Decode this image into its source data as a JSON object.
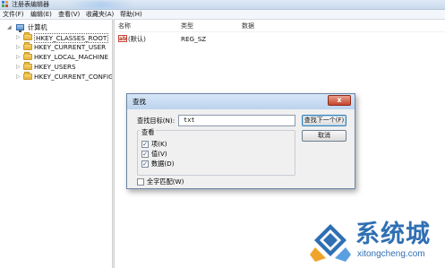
{
  "window": {
    "title": "注册表编辑器"
  },
  "menu": {
    "items": [
      "文件(F)",
      "编辑(E)",
      "查看(V)",
      "收藏夹(A)",
      "帮助(H)"
    ]
  },
  "tree": {
    "root_label": "计算机",
    "items": [
      {
        "label": "HKEY_CLASSES_ROOT",
        "selected": true
      },
      {
        "label": "HKEY_CURRENT_USER"
      },
      {
        "label": "HKEY_LOCAL_MACHINE"
      },
      {
        "label": "HKEY_USERS"
      },
      {
        "label": "HKEY_CURRENT_CONFIG"
      }
    ]
  },
  "list": {
    "columns": [
      "名称",
      "类型",
      "数据"
    ],
    "rows": [
      {
        "name": "(默认)",
        "type": "REG_SZ",
        "data": ""
      }
    ]
  },
  "find_dialog": {
    "title": "查找",
    "close_label": "x",
    "find_label": "查找目标(N):",
    "find_value": "txt",
    "find_next_label": "查找下一个(F)",
    "cancel_label": "取消",
    "look_at_label": "查看",
    "options": [
      {
        "label": "项(K)",
        "checked": true
      },
      {
        "label": "值(V)",
        "checked": true
      },
      {
        "label": "数据(D)",
        "checked": true
      }
    ],
    "match_whole_label": "全字匹配(W)",
    "match_whole_checked": false
  },
  "watermark": {
    "brand": "系统城",
    "url": "xitongcheng.com"
  },
  "colors": {
    "accent": "#2f6fb3",
    "folder": "#e8b33e",
    "close_button": "#c7442b"
  }
}
